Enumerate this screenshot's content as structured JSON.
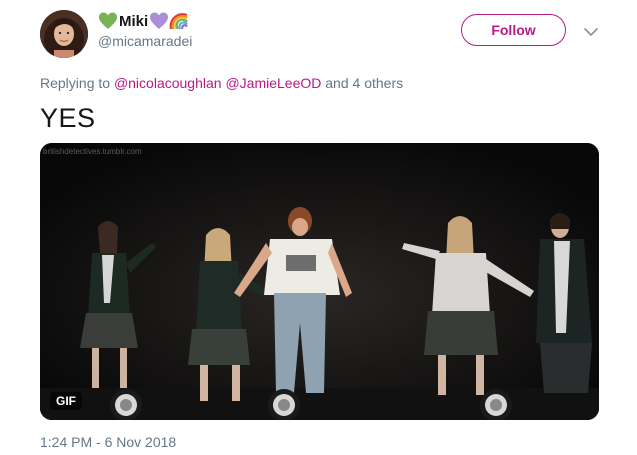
{
  "user": {
    "display_name": "Miki",
    "handle": "@micamaradei",
    "emoji_before": "green-heart",
    "emoji_after": [
      "purple-heart",
      "rainbow"
    ]
  },
  "follow_label": "Follow",
  "reply": {
    "prefix": "Replying to",
    "mentions": [
      "@nicolacoughlan",
      "@JamieLeeOD"
    ],
    "suffix": "and 4 others"
  },
  "tweet_text": "YES",
  "media": {
    "watermark": "britishdetectives.tumblr.com",
    "badge": "GIF"
  },
  "timestamp": "1:24 PM - 6 Nov 2018",
  "colors": {
    "accent": "#b71a8a",
    "secondary_text": "#657786",
    "primary_text": "#14171a"
  }
}
